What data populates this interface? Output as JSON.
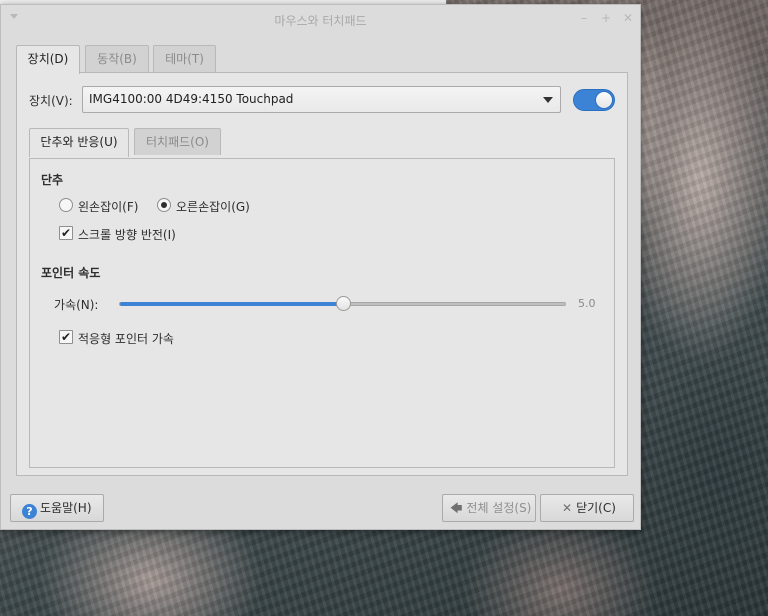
{
  "window": {
    "title": "마우스와 터치패드",
    "controls": {
      "minimize": "–",
      "maximize": "+",
      "close": "✕"
    }
  },
  "tabs": [
    {
      "label": "장치(D)",
      "active": true
    },
    {
      "label": "동작(B)",
      "active": false
    },
    {
      "label": "테마(T)",
      "active": false
    }
  ],
  "device": {
    "label": "장치(V):",
    "selected": "IMG4100:00 4D49:4150 Touchpad",
    "enabled": true
  },
  "inner_tabs": [
    {
      "label": "단추와 반응(U)",
      "active": true
    },
    {
      "label": "터치패드(O)",
      "active": false
    }
  ],
  "buttons_section": {
    "title": "단추",
    "left_handed": "왼손잡이(F)",
    "right_handed": "오른손잡이(G)",
    "selected": "right",
    "reverse_scroll": "스크롤 방향 반전(I)",
    "reverse_scroll_checked": true
  },
  "pointer_section": {
    "title": "포인터 속도",
    "accel_label": "가속(N):",
    "accel_value": "5.0",
    "accel_fraction": 0.5,
    "adaptive": "적응형 포인터 가속",
    "adaptive_checked": true
  },
  "footer": {
    "help": "도움말(H)",
    "all_settings": "전체 설정(S)",
    "close": "닫기(C)"
  },
  "colors": {
    "accent": "#3c83d6",
    "window_bg": "#dcdcdc",
    "panel_bg": "#e6e6e6"
  }
}
